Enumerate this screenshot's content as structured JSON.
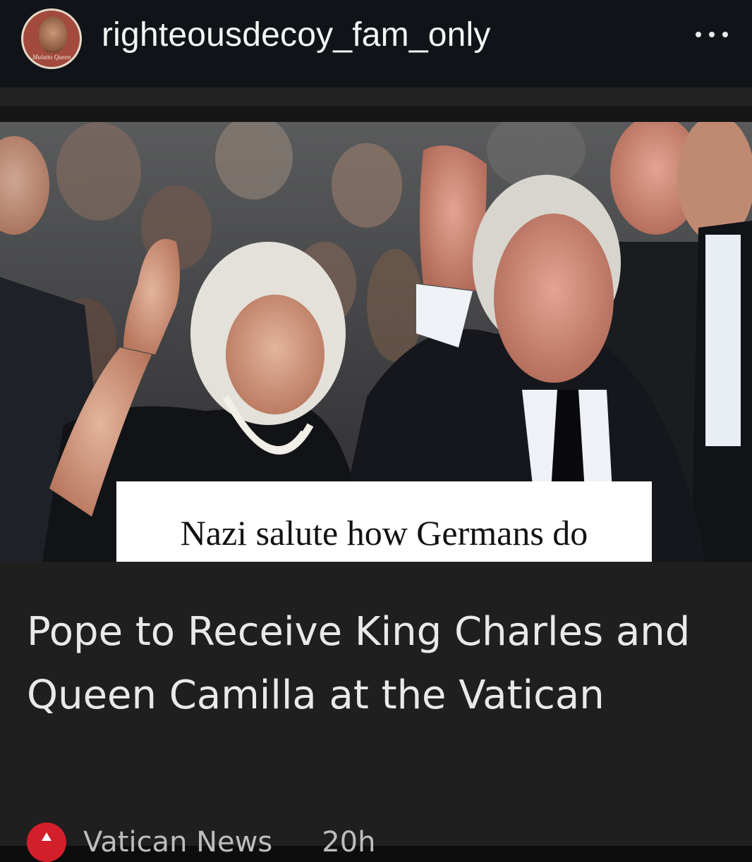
{
  "header": {
    "username": "righteousdecoy_fam_only",
    "avatar_caption": "Mulatto Queen",
    "more_icon": "more-horizontal-icon"
  },
  "post": {
    "overlay_caption": "Nazi salute how Germans do",
    "headline": "Pope to Receive King Charles and Queen Camilla at the Vatican",
    "source_name": "Vatican News",
    "source_time": "20h",
    "source_icon": "news-source-icon"
  },
  "colors": {
    "header_bg": "#101418",
    "card_bg": "#1f1f1f",
    "headline_text": "#e9e9e9",
    "source_icon": "#d31f2a"
  }
}
